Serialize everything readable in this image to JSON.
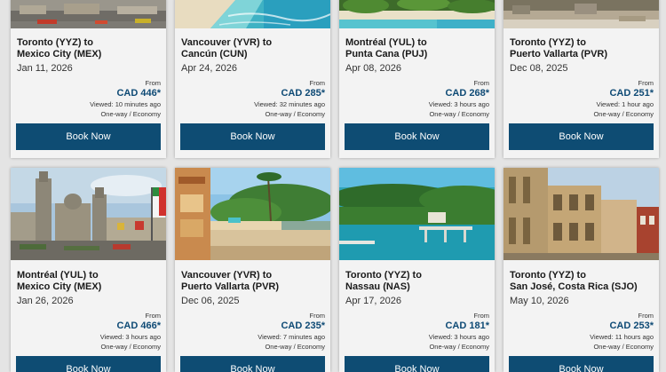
{
  "deals": [
    {
      "origin": "Toronto (YYZ) to",
      "destination": "Mexico City (MEX)",
      "date": "Jan 11, 2026",
      "from_label": "From",
      "price": "CAD 446*",
      "viewed": "Viewed: 10 minutes ago",
      "fare_type": "One-way / Economy",
      "button": "Book Now"
    },
    {
      "origin": "Vancouver (YVR) to",
      "destination": "Cancún (CUN)",
      "date": "Apr 24, 2026",
      "from_label": "From",
      "price": "CAD 285*",
      "viewed": "Viewed: 32 minutes ago",
      "fare_type": "One-way / Economy",
      "button": "Book Now"
    },
    {
      "origin": "Montréal (YUL) to",
      "destination": "Punta Cana (PUJ)",
      "date": "Apr 08, 2026",
      "from_label": "From",
      "price": "CAD 268*",
      "viewed": "Viewed: 3 hours ago",
      "fare_type": "One-way / Economy",
      "button": "Book Now"
    },
    {
      "origin": "Toronto (YYZ) to",
      "destination": "Puerto Vallarta (PVR)",
      "date": "Dec 08, 2025",
      "from_label": "From",
      "price": "CAD 251*",
      "viewed": "Viewed: 1 hour ago",
      "fare_type": "One-way / Economy",
      "button": "Book Now"
    },
    {
      "origin": "Montréal (YUL) to",
      "destination": "Mexico City (MEX)",
      "date": "Jan 26, 2026",
      "from_label": "From",
      "price": "CAD 466*",
      "viewed": "Viewed: 3 hours ago",
      "fare_type": "One-way / Economy",
      "button": "Book Now"
    },
    {
      "origin": "Vancouver (YVR) to",
      "destination": "Puerto Vallarta (PVR)",
      "date": "Dec 06, 2025",
      "from_label": "From",
      "price": "CAD 235*",
      "viewed": "Viewed: 7 minutes ago",
      "fare_type": "One-way / Economy",
      "button": "Book Now"
    },
    {
      "origin": "Toronto (YYZ) to",
      "destination": "Nassau (NAS)",
      "date": "Apr 17, 2026",
      "from_label": "From",
      "price": "CAD 181*",
      "viewed": "Viewed: 3 hours ago",
      "fare_type": "One-way / Economy",
      "button": "Book Now"
    },
    {
      "origin": "Toronto (YYZ) to",
      "destination": "San José, Costa Rica (SJO)",
      "date": "May 10, 2026",
      "from_label": "From",
      "price": "CAD 253*",
      "viewed": "Viewed: 11 hours ago",
      "fare_type": "One-way / Economy",
      "button": "Book Now"
    }
  ],
  "colors": {
    "button": "#0e4c73",
    "price": "#0e4a75",
    "card": "#f3f3f3",
    "background": "#e4e4e4"
  }
}
